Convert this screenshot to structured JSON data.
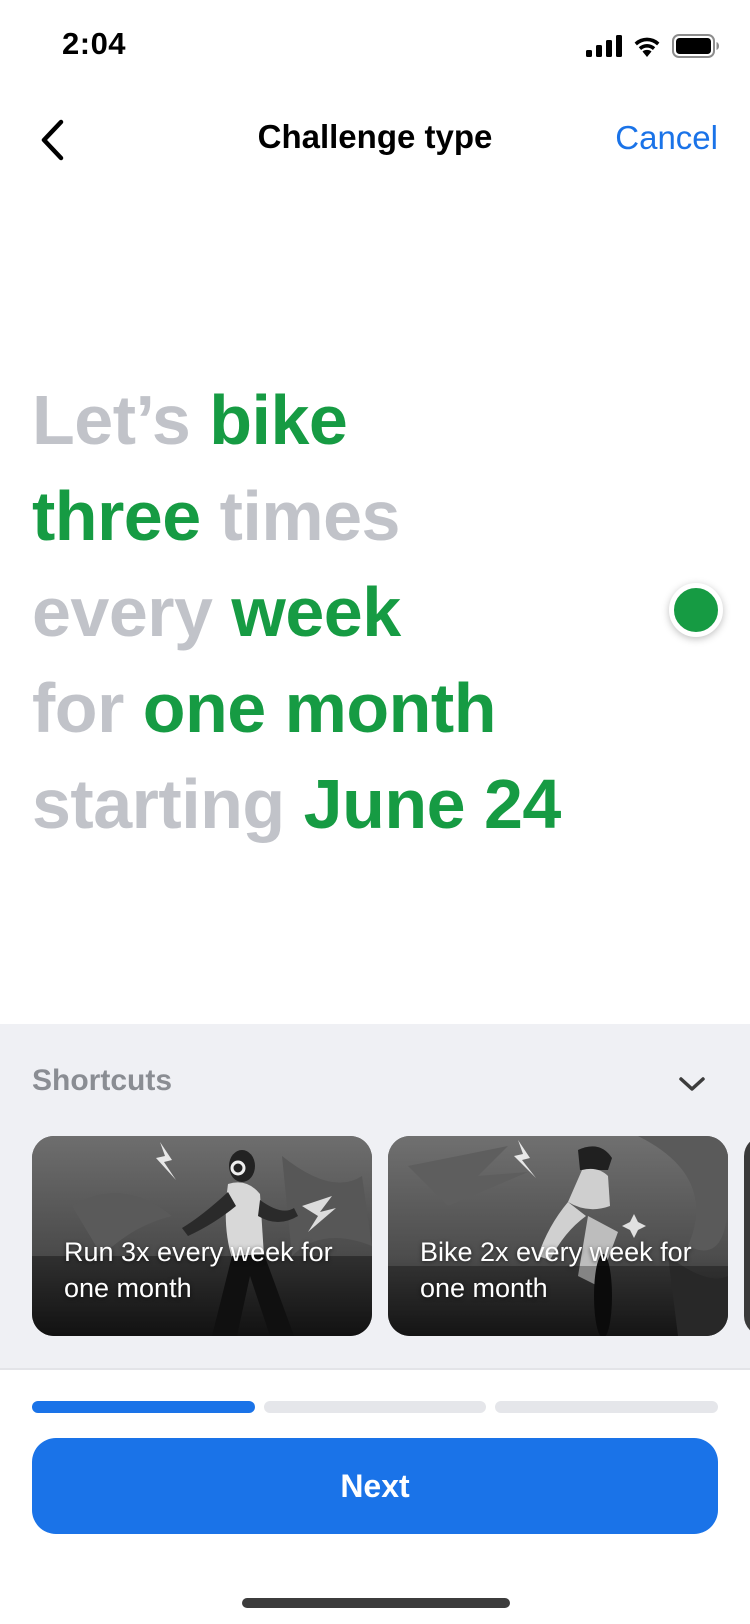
{
  "status_bar": {
    "time": "2:04"
  },
  "nav": {
    "title": "Challenge type",
    "cancel_label": "Cancel"
  },
  "sentence": {
    "lines": [
      {
        "muted": "Let’s ",
        "accent": "bike",
        "trail": ""
      },
      {
        "muted": "",
        "accent": "three",
        "trail": " times"
      },
      {
        "muted": "every ",
        "accent": "week",
        "trail": ""
      },
      {
        "muted": "for ",
        "accent": "one month",
        "trail": ""
      },
      {
        "muted": "starting ",
        "accent": "June 24",
        "trail": ""
      }
    ]
  },
  "shortcuts": {
    "title": "Shortcuts",
    "cards": [
      {
        "label": "Run 3x every week for one month",
        "image": "runner-photo"
      },
      {
        "label": "Bike 2x every week for one month",
        "image": "cyclist-photo"
      }
    ]
  },
  "progress": {
    "steps_total": 3,
    "current_step": 1
  },
  "next_button": {
    "label": "Next"
  },
  "colors": {
    "accent_green": "#169b43",
    "primary_blue": "#1a73e8",
    "muted_gray": "#c1c3c9"
  }
}
